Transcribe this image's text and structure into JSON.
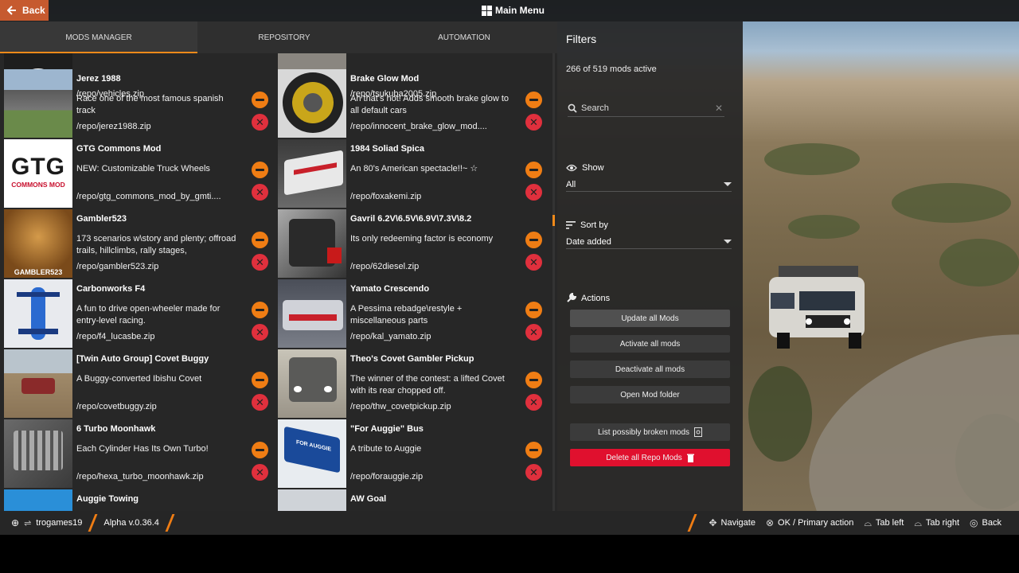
{
  "topbar": {
    "back_label": "Back",
    "main_menu_label": "Main Menu"
  },
  "tabs": [
    {
      "label": "MODS MANAGER",
      "active": true
    },
    {
      "label": "REPOSITORY",
      "active": false
    },
    {
      "label": "AUTOMATION",
      "active": false
    }
  ],
  "mods_col1": [
    {
      "name": "",
      "desc": "",
      "path": "/repo/vehicles.zip"
    },
    {
      "name": "Jerez 1988",
      "desc": "Race one of the most famous spanish track",
      "path": "/repo/jerez1988.zip"
    },
    {
      "name": "GTG Commons Mod",
      "desc": "NEW: Customizable Truck Wheels",
      "path": "/repo/gtg_commons_mod_by_gmti...."
    },
    {
      "name": "Gambler523",
      "desc": "173 scenarios w\\story and plenty; offroad trails, hillclimbs, rally stages,",
      "path": "/repo/gambler523.zip"
    },
    {
      "name": "Carbonworks F4",
      "desc": "A fun to drive open-wheeler made for entry-level racing.",
      "path": "/repo/f4_lucasbe.zip"
    },
    {
      "name": "[Twin Auto Group] Covet Buggy",
      "desc": "A Buggy-converted Ibishu Covet",
      "path": "/repo/covetbuggy.zip"
    },
    {
      "name": "6 Turbo Moonhawk",
      "desc": "Each Cylinder Has Its Own Turbo!",
      "path": "/repo/hexa_turbo_moonhawk.zip"
    },
    {
      "name": "Auggie Towing",
      "desc": "",
      "path": ""
    }
  ],
  "mods_col2": [
    {
      "name": "",
      "desc": "",
      "path": "/repo/tsukuba2005.zip"
    },
    {
      "name": "Brake Glow Mod",
      "desc": "Ah that's hot! Adds smooth brake glow to all default cars",
      "path": "/repo/innocent_brake_glow_mod...."
    },
    {
      "name": "1984 Soliad Spica",
      "desc": "An 80's American spectacle!!~ ☆",
      "path": "/repo/foxakemi.zip"
    },
    {
      "name": "Gavril 6.2V\\6.5V\\6.9V\\7.3V\\8.2",
      "desc": "Its only redeeming factor is economy",
      "path": "/repo/62diesel.zip"
    },
    {
      "name": "Yamato Crescendo",
      "desc": "A Pessima rebadge\\restyle + miscellaneous parts",
      "path": "/repo/kal_yamato.zip"
    },
    {
      "name": "Theo's Covet Gambler Pickup",
      "desc": "The winner of the contest: a lifted Covet with its rear chopped off.",
      "path": "/repo/thw_covetpickup.zip"
    },
    {
      "name": "\"For Auggie\" Bus",
      "desc": "A tribute to Auggie",
      "path": "/repo/forauggie.zip"
    },
    {
      "name": "AW Goal",
      "desc": "",
      "path": ""
    }
  ],
  "thumb_text": {
    "gtg_big": "GTG",
    "gtg_small": "COMMONS MOD",
    "gambler": "GAMBLER523",
    "bus": "FOR AUGGIE"
  },
  "filters": {
    "title": "Filters",
    "count": "266 of 519 mods active",
    "search_placeholder": "Search",
    "show_label": "Show",
    "show_value": "All",
    "sort_label": "Sort by",
    "sort_value": "Date added",
    "actions_label": "Actions",
    "actions": [
      "Update all Mods",
      "Activate all mods",
      "Deactivate all mods",
      "Open Mod folder"
    ],
    "broken_label": "List possibly broken mods",
    "delete_label": "Delete all Repo Mods"
  },
  "bottombar": {
    "user": "trogames19",
    "version": "Alpha v.0.36.4",
    "hints": [
      "Navigate",
      "OK / Primary action",
      "Tab left",
      "Tab right",
      "Back"
    ]
  },
  "colors": {
    "accent": "#ef7d14",
    "danger": "#e0303d",
    "delete_all": "#e0102e"
  },
  "icons": [
    "arrow-left-icon",
    "grid-icon",
    "search-icon",
    "close-icon",
    "eye-icon",
    "sort-icon",
    "wrench-icon",
    "trash-icon",
    "magnifier-doc-icon",
    "gamepad-icon",
    "dpad-icon",
    "button-b-icon"
  ]
}
